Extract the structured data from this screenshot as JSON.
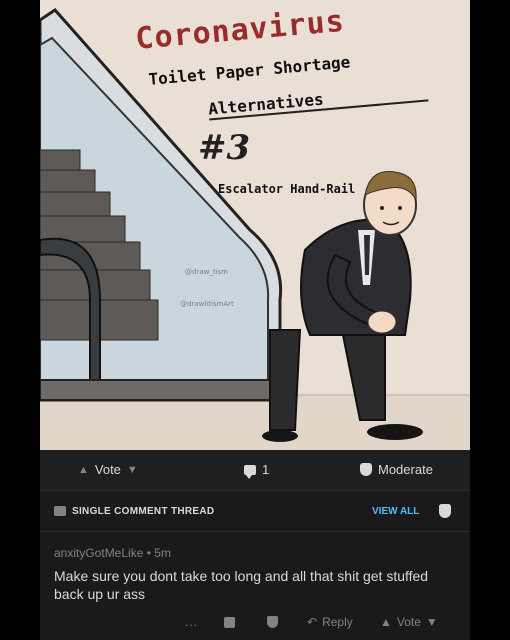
{
  "comic": {
    "title_line1": "Coronavirus",
    "title_line2": "Toilet Paper Shortage",
    "title_line3": "Alternatives",
    "number": "#3",
    "subtitle": "Escalator Hand-Rail",
    "watermark1": "@draw_tism",
    "watermark2": "@drawlitismArt"
  },
  "post_actions": {
    "vote_label": "Vote",
    "comment_count": "1",
    "moderate_label": "Moderate"
  },
  "thread_bar": {
    "label": "SINGLE COMMENT THREAD",
    "view_all": "VIEW ALL"
  },
  "comment": {
    "author": "anxityGotMeLike",
    "separator": "•",
    "age": "5m",
    "text": "Make sure you dont take too long and all that shit get stuffed back up ur ass",
    "more": "...",
    "reply_label": "Reply",
    "vote_label": "Vote"
  }
}
